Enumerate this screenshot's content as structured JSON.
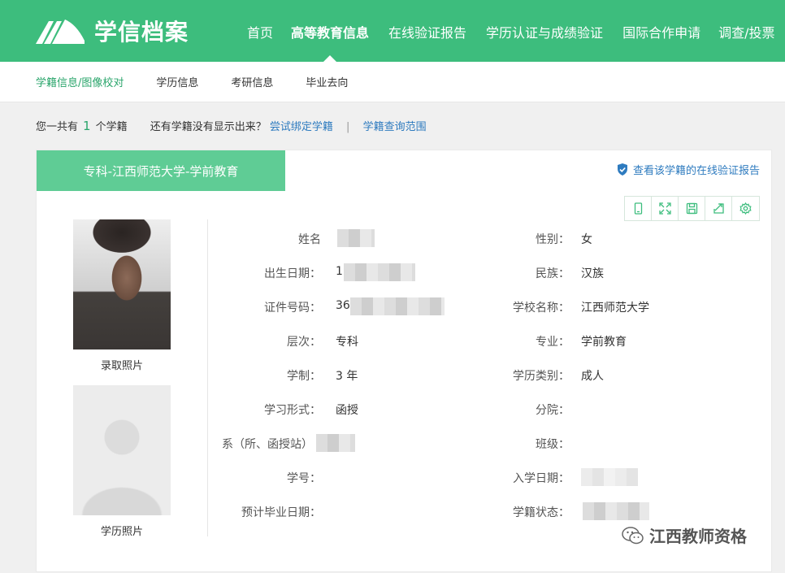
{
  "header": {
    "logo_text": "学信档案",
    "nav": [
      "首页",
      "高等教育信息",
      "在线验证报告",
      "学历认证与成绩验证",
      "国际合作申请",
      "调查/投票"
    ],
    "active_nav_index": 1,
    "brand_color": "#3dbd7d"
  },
  "subnav": {
    "items": [
      "学籍信息/图像校对",
      "学历信息",
      "考研信息",
      "毕业去向"
    ],
    "active_index": 0
  },
  "summary": {
    "prefix": "您一共有",
    "count": "1",
    "suffix": "个学籍",
    "question": "还有学籍没有显示出来？",
    "bind_link": "尝试绑定学籍",
    "separator": "|",
    "scope_link": "学籍查询范围"
  },
  "card": {
    "title": "专科-江西师范大学-学前教育",
    "verify_link": "查看该学籍的在线验证报告",
    "toolbar_icons": [
      "phone-icon",
      "fullscreen-icon",
      "save-icon",
      "share-icon",
      "settings-icon"
    ],
    "photos": {
      "admission_label": "录取照片",
      "degree_label": "学历照片"
    },
    "left_fields": [
      {
        "label": "姓名",
        "value": ""
      },
      {
        "label": "出生日期：",
        "value": "1"
      },
      {
        "label": "证件号码：",
        "value": "36"
      },
      {
        "label": "层次：",
        "value": "专科"
      },
      {
        "label": "学制：",
        "value": "3 年"
      },
      {
        "label": "学习形式：",
        "value": "函授"
      },
      {
        "label": "系（所、函授站）",
        "value": ""
      },
      {
        "label": "学号：",
        "value": ""
      },
      {
        "label": "预计毕业日期：",
        "value": ""
      }
    ],
    "right_fields": [
      {
        "label": "性别：",
        "value": "女"
      },
      {
        "label": "民族：",
        "value": "汉族"
      },
      {
        "label": "学校名称：",
        "value": "江西师范大学"
      },
      {
        "label": "专业：",
        "value": "学前教育"
      },
      {
        "label": "学历类别：",
        "value": "成人"
      },
      {
        "label": "分院：",
        "value": ""
      },
      {
        "label": "班级：",
        "value": ""
      },
      {
        "label": "入学日期：",
        "value": ""
      },
      {
        "label": "学籍状态：",
        "value": ""
      }
    ]
  },
  "footer_watermark": "江西教师资格"
}
